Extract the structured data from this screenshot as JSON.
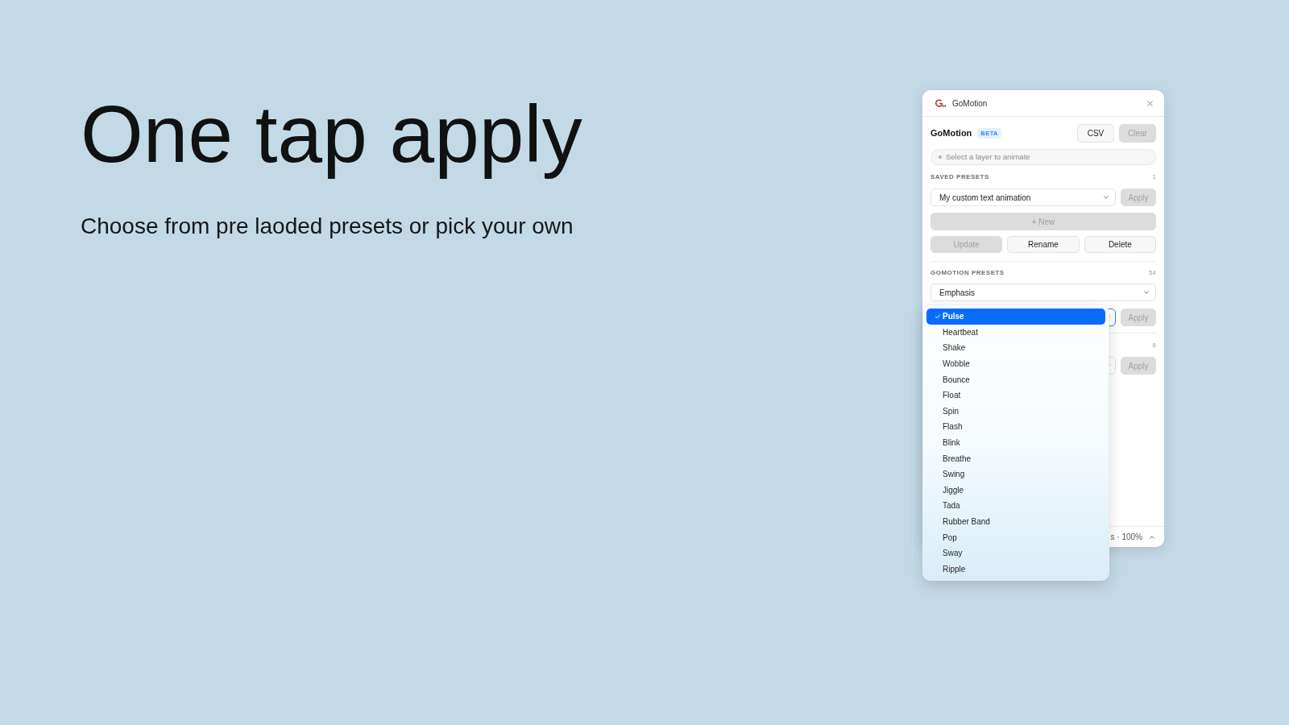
{
  "hero": {
    "headline": "One tap apply",
    "subtitle": "Choose from pre laoded presets or pick your own"
  },
  "window": {
    "title": "GoMotion"
  },
  "panel": {
    "title": "GoMotion",
    "badge": "BETA",
    "header_buttons": [
      {
        "label": "CSV",
        "disabled": false
      },
      {
        "label": "Clear",
        "disabled": true
      }
    ],
    "status": {
      "text": "Select a layer to animate"
    },
    "saved_presets": {
      "label": "SAVED PRESETS",
      "count": "1",
      "select_value": "My custom text animation",
      "apply": {
        "label": "Apply",
        "disabled": true
      },
      "new_button": {
        "label": "+ New",
        "disabled": true
      },
      "actions": [
        {
          "label": "Update",
          "disabled": true
        },
        {
          "label": "Rename",
          "disabled": false
        },
        {
          "label": "Delete",
          "disabled": false
        }
      ]
    },
    "gomotion_presets": {
      "label": "GOMOTION PRESETS",
      "count": "54",
      "category": "Emphasis",
      "preset_select": {
        "focused": true
      },
      "apply": {
        "label": "Apply",
        "disabled": true
      }
    },
    "section_3": {
      "count": "6",
      "apply": {
        "label": "Apply",
        "disabled": true
      }
    },
    "footer": {
      "text": "s · 100%"
    }
  },
  "dropdown": {
    "items": [
      {
        "label": "Pulse",
        "selected": true
      },
      {
        "label": "Heartbeat",
        "selected": false
      },
      {
        "label": "Shake",
        "selected": false
      },
      {
        "label": "Wobble",
        "selected": false
      },
      {
        "label": "Bounce",
        "selected": false
      },
      {
        "label": "Float",
        "selected": false
      },
      {
        "label": "Spin",
        "selected": false
      },
      {
        "label": "Flash",
        "selected": false
      },
      {
        "label": "Blink",
        "selected": false
      },
      {
        "label": "Breathe",
        "selected": false
      },
      {
        "label": "Swing",
        "selected": false
      },
      {
        "label": "Jiggle",
        "selected": false
      },
      {
        "label": "Tada",
        "selected": false
      },
      {
        "label": "Rubber Band",
        "selected": false
      },
      {
        "label": "Pop",
        "selected": false
      },
      {
        "label": "Sway",
        "selected": false
      },
      {
        "label": "Ripple",
        "selected": false
      }
    ]
  }
}
